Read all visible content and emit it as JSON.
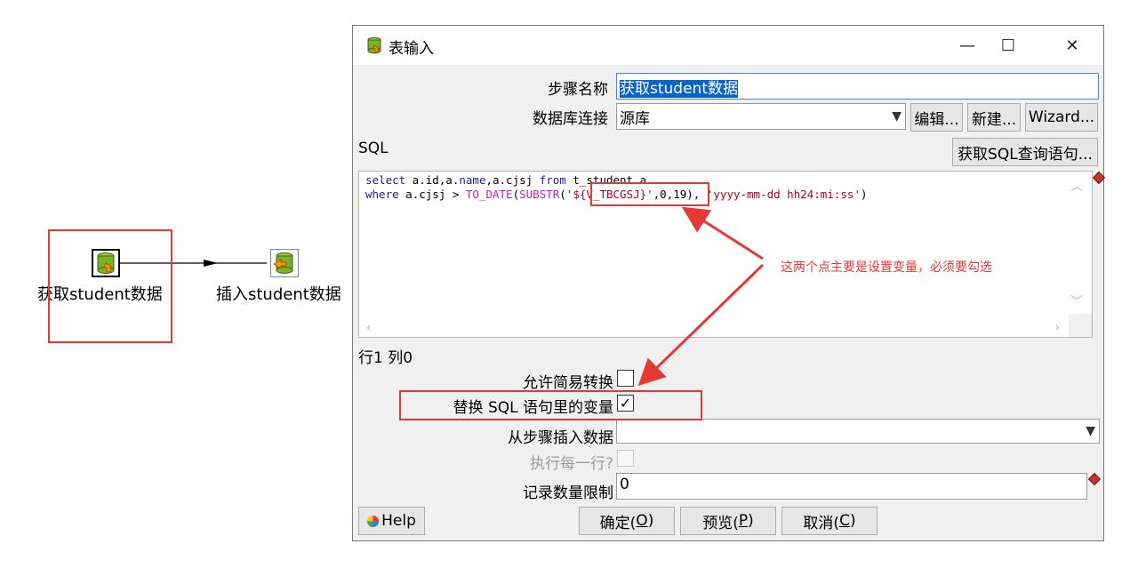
{
  "canvas": {
    "step1_label": "获取student数据",
    "step2_label": "插入student数据"
  },
  "dialog": {
    "title": "表输入",
    "window_controls": {
      "minimize": "—",
      "maximize": "☐",
      "close": "✕"
    },
    "step_name_label": "步骤名称",
    "step_name_value": "获取student数据",
    "db_conn_label": "数据库连接",
    "db_conn_value": "源库",
    "edit_button": "编辑...",
    "new_button": "新建...",
    "wizard_button": "Wizard...",
    "sql_label": "SQL",
    "get_sql_button": "获取SQL查询语句...",
    "sql_lines": [
      [
        {
          "t": "select",
          "c": "kw"
        },
        {
          "t": " a.id,a.",
          "c": "plain"
        },
        {
          "t": "name",
          "c": "kw"
        },
        {
          "t": ",a.cjsj ",
          "c": "plain"
        },
        {
          "t": "from",
          "c": "kw"
        },
        {
          "t": " t_student a",
          "c": "plain"
        }
      ],
      [
        {
          "t": "where",
          "c": "kw"
        },
        {
          "t": " a.cjsj > ",
          "c": "plain"
        },
        {
          "t": "TO_DATE",
          "c": "fn"
        },
        {
          "t": "(",
          "c": "plain"
        },
        {
          "t": "SUBSTR",
          "c": "fn"
        },
        {
          "t": "(",
          "c": "plain"
        },
        {
          "t": "'${V_TBCGSJ}'",
          "c": "str"
        },
        {
          "t": ",0,19), ",
          "c": "plain"
        },
        {
          "t": "'yyyy-mm-dd hh24:mi:ss'",
          "c": "str"
        },
        {
          "t": ")",
          "c": "plain"
        }
      ]
    ],
    "cursor_pos": "行1 列0",
    "lazy_conversion_label": "允许简易转换",
    "lazy_conversion_checked": false,
    "replace_vars_label": "替换 SQL 语句里的变量",
    "replace_vars_checked": true,
    "insert_from_step_label": "从步骤插入数据",
    "insert_from_step_value": "",
    "execute_each_row_label": "执行每一行?",
    "limit_label": "记录数量限制",
    "limit_value": "0",
    "help_button": "Help",
    "ok_button": {
      "text": "确定(",
      "key": "O",
      "end": ")"
    },
    "preview_button": {
      "text": "预览(",
      "key": "P",
      "end": ")"
    },
    "cancel_button": {
      "text": "取消(",
      "key": "C",
      "end": ")"
    }
  },
  "annotation": {
    "text": "这两个点主要是设置变量，必须要勾选",
    "color": "#e53935"
  },
  "colors": {
    "keyword": "#1c1ca8",
    "function": "#c21ec2",
    "string": "#b2001e",
    "highlight": "#e53935",
    "selection": "#0a64c8"
  }
}
